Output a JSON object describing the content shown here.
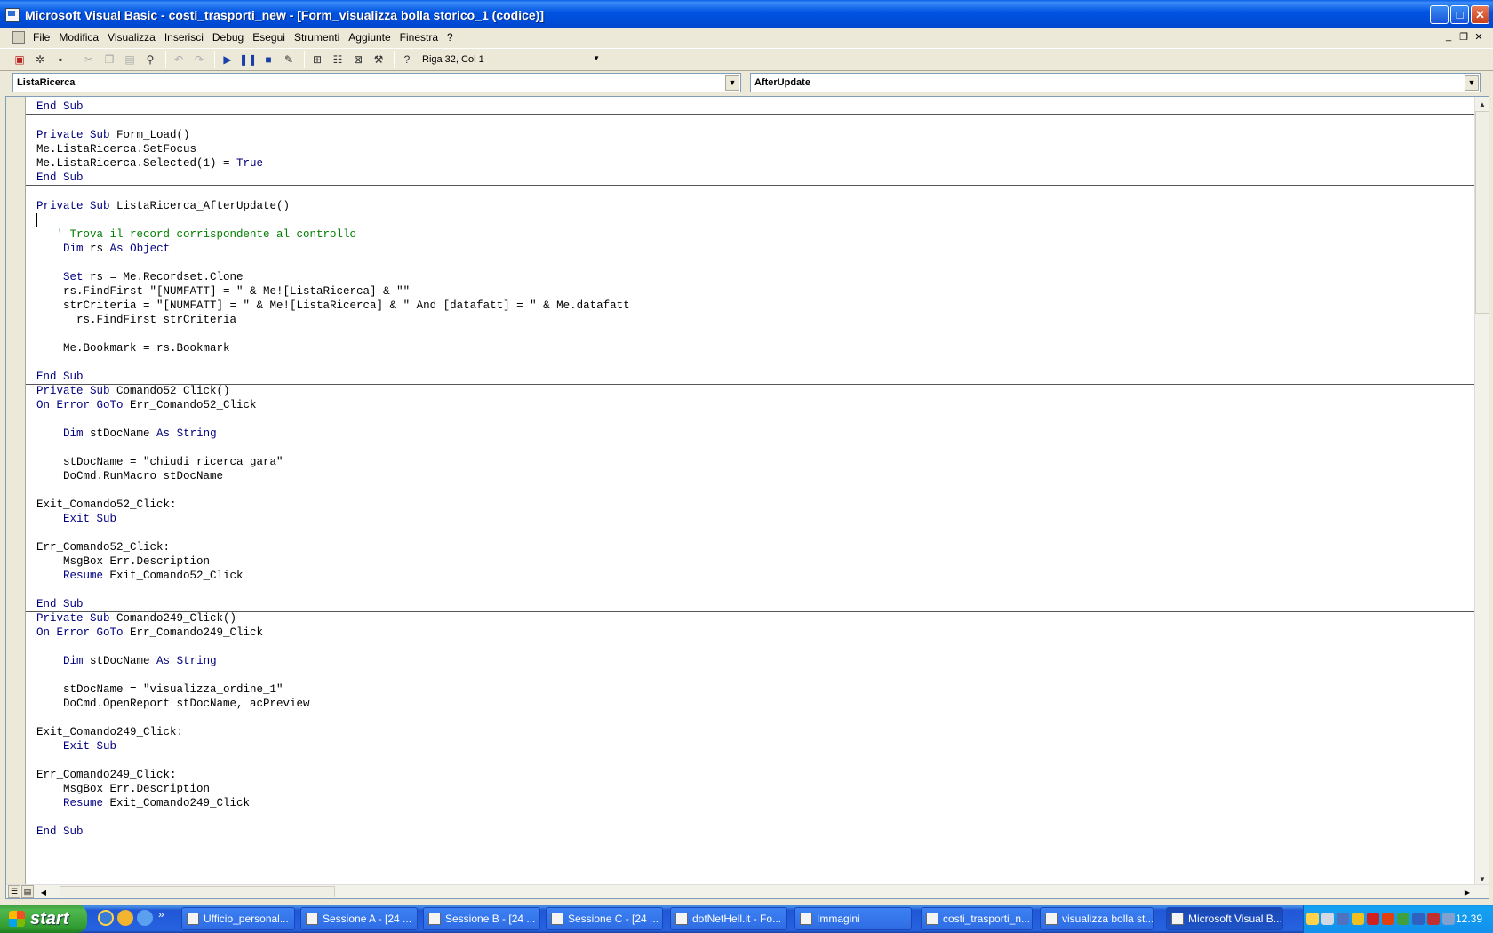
{
  "window": {
    "title": "Microsoft Visual Basic - costi_trasporti_new - [Form_visualizza bolla storico_1 (codice)]"
  },
  "menu": {
    "items": [
      "File",
      "Modifica",
      "Visualizza",
      "Inserisci",
      "Debug",
      "Esegui",
      "Strumenti",
      "Aggiunte",
      "Finestra",
      "?"
    ]
  },
  "toolbar": {
    "position": "Riga 32, Col 1"
  },
  "object_combo": {
    "value": "ListaRicerca"
  },
  "procedure_combo": {
    "value": "AfterUpdate"
  },
  "code": [
    "End Sub",
    "",
    "Private Sub Form_Load()",
    "Me.ListaRicerca.SetFocus",
    "Me.ListaRicerca.Selected(1) = True",
    "End Sub",
    "",
    "Private Sub ListaRicerca_AfterUpdate()",
    "",
    "   ' Trova il record corrispondente al controllo",
    "    Dim rs As Object",
    "",
    "    Set rs = Me.Recordset.Clone",
    "    rs.FindFirst \"[NUMFATT] = \" & Me![ListaRicerca] & \"\"",
    "    strCriteria = \"[NUMFATT] = \" & Me![ListaRicerca] & \" And [datafatt] = \" & Me.datafatt",
    "      rs.FindFirst strCriteria",
    "",
    "    Me.Bookmark = rs.Bookmark",
    "",
    "End Sub",
    "Private Sub Comando52_Click()",
    "On Error GoTo Err_Comando52_Click",
    "",
    "    Dim stDocName As String",
    "",
    "    stDocName = \"chiudi_ricerca_gara\"",
    "    DoCmd.RunMacro stDocName",
    "",
    "Exit_Comando52_Click:",
    "    Exit Sub",
    "",
    "Err_Comando52_Click:",
    "    MsgBox Err.Description",
    "    Resume Exit_Comando52_Click",
    "",
    "End Sub",
    "Private Sub Comando249_Click()",
    "On Error GoTo Err_Comando249_Click",
    "",
    "    Dim stDocName As String",
    "",
    "    stDocName = \"visualizza_ordine_1\"",
    "    DoCmd.OpenReport stDocName, acPreview",
    "",
    "Exit_Comando249_Click:",
    "    Exit Sub",
    "",
    "Err_Comando249_Click:",
    "    MsgBox Err.Description",
    "    Resume Exit_Comando249_Click",
    "",
    "End Sub"
  ],
  "taskbar": {
    "start_label": "start",
    "tasks": [
      "Ufficio_personal...",
      "Sessione A - [24 ...",
      "Sessione B - [24 ...",
      "Sessione C - [24 ...",
      "dotNetHell.it - Fo...",
      "Immagini",
      "costi_trasporti_n...",
      "visualizza bolla st...",
      "Microsoft Visual B..."
    ],
    "clock": "12.39"
  }
}
